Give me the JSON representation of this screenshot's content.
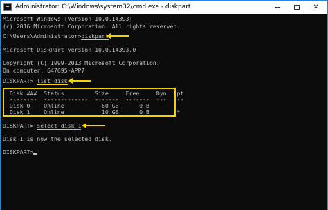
{
  "window": {
    "title": "Administrator: C:\\Windows\\system32\\cmd.exe - diskpart",
    "controls": {
      "minimize": "minimize",
      "maximize": "maximize",
      "close": "✕"
    }
  },
  "console": {
    "lines": [
      "Microsoft Windows [Version 10.0.14393]",
      "(c) 2016 Microsoft Corporation. All rights reserved.",
      "",
      "C:\\Users\\Administrator>",
      "",
      "Microsoft DiskPart version 10.0.14393.0",
      "",
      "Copyright (C) 1999-2013 Microsoft Corporation.",
      "On computer: 647695-APP7",
      "",
      "DISKPART> ",
      "",
      "  Disk ###  Status         Size     Free     Dyn  Gpt",
      "  --------  -------------  -------  -------  ---  ---",
      "  Disk 0    Online           60 GB      0 B",
      "  Disk 1    Online           10 GB      0 B        *",
      "",
      "DISKPART> ",
      "",
      "Disk 1 is now the selected disk.",
      "",
      "DISKPART> "
    ],
    "commands": {
      "line3": "diskpart",
      "line10": "list disk",
      "line17": "select disk 1"
    }
  },
  "accent": "#f5d000",
  "console_bg": "#0c0c0c",
  "console_fg": "#c0c0c0"
}
